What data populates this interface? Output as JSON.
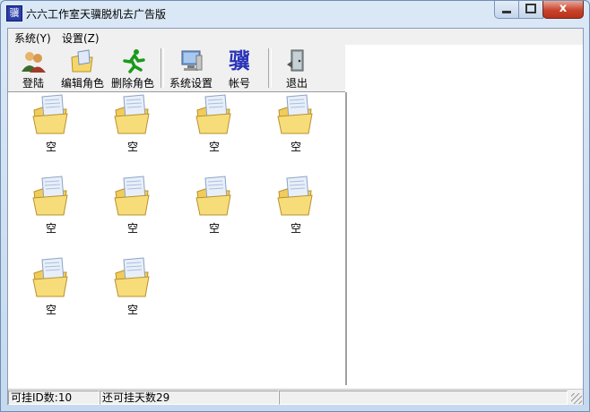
{
  "window": {
    "title": "六六工作室天骥脱机去广告版",
    "app_icon_glyph": "骥",
    "close_glyph": "x"
  },
  "menu": [
    {
      "label": "系统(Y)"
    },
    {
      "label": "设置(Z)"
    }
  ],
  "toolbar": {
    "login": {
      "label": "登陆",
      "icon": "users-icon"
    },
    "edit_role": {
      "label": "编辑角色",
      "icon": "folder-edit-icon"
    },
    "delete_role": {
      "label": "删除角色",
      "icon": "running-man-icon"
    },
    "system_settings": {
      "label": "系统设置",
      "icon": "computer-icon"
    },
    "account": {
      "label": "帐号",
      "icon_glyph": "骥"
    },
    "exit": {
      "label": "退出",
      "icon": "exit-door-icon"
    }
  },
  "slots": [
    {
      "label": "空"
    },
    {
      "label": "空"
    },
    {
      "label": "空"
    },
    {
      "label": "空"
    },
    {
      "label": "空"
    },
    {
      "label": "空"
    },
    {
      "label": "空"
    },
    {
      "label": "空"
    },
    {
      "label": "空"
    },
    {
      "label": "空"
    }
  ],
  "status": {
    "id_count": "可挂ID数:10",
    "days_left": "还可挂天数29",
    "cell3": ""
  },
  "colors": {
    "folder": "#f5d66b",
    "accent": "#2c3ea6",
    "close": "#c8432c"
  }
}
